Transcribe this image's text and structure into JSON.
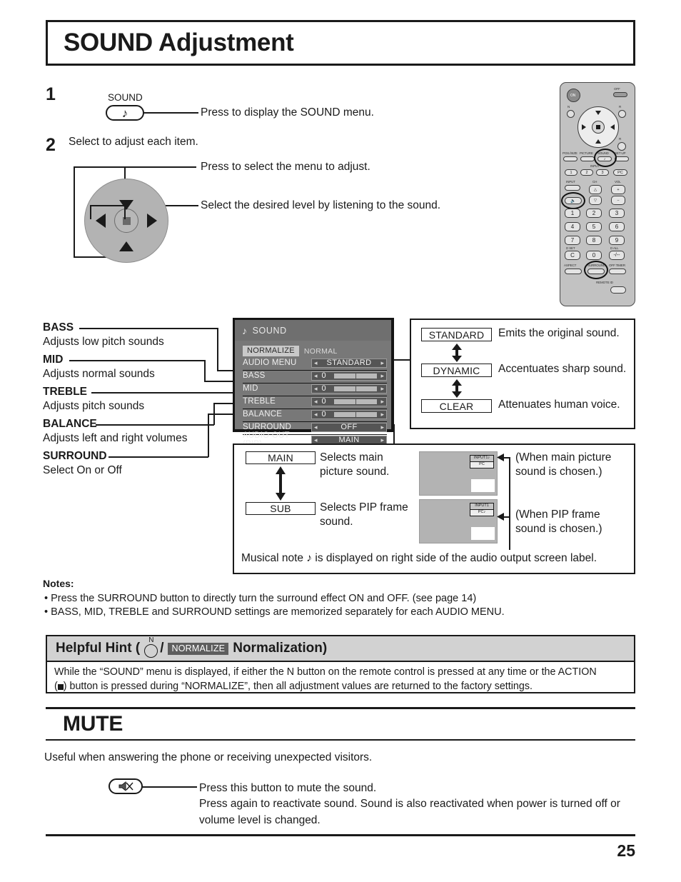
{
  "page": {
    "title": "SOUND Adjustment",
    "number": "25"
  },
  "steps": [
    {
      "num": "1",
      "button_label": "SOUND",
      "button_icon": "music-note-icon",
      "text": "Press to display the SOUND menu."
    },
    {
      "num": "2",
      "heading": "Select to adjust each item.",
      "line1": "Press to select the menu to adjust.",
      "line2": "Select the desired level by listening to the sound."
    }
  ],
  "left_items": [
    {
      "name": "BASS",
      "desc": "Adjusts low pitch sounds"
    },
    {
      "name": "MID",
      "desc": "Adjusts normal sounds"
    },
    {
      "name": "TREBLE",
      "desc": "Adjusts pitch sounds"
    },
    {
      "name": "BALANCE",
      "desc": "Adjusts left and right volumes"
    },
    {
      "name": "SURROUND",
      "desc": "Select On or Off"
    }
  ],
  "osd": {
    "title": "SOUND",
    "title_icon": "music-note-icon",
    "normalize_badge": "NORMALIZE",
    "normalize_value": "NORMAL",
    "rows": [
      {
        "label": "AUDIO MENU",
        "value": "STANDARD",
        "type": "value"
      },
      {
        "label": "BASS",
        "value": "0",
        "type": "slider"
      },
      {
        "label": "MID",
        "value": "0",
        "type": "slider"
      },
      {
        "label": "TREBLE",
        "value": "0",
        "type": "slider"
      },
      {
        "label": "BALANCE",
        "value": "0",
        "type": "slider"
      },
      {
        "label": "SURROUND",
        "value": "OFF",
        "type": "value"
      },
      {
        "label": "AUDIO OUT (PIP)",
        "value": "MAIN",
        "type": "value"
      }
    ],
    "arrow_left": "◂",
    "arrow_right": "▸"
  },
  "audio_menu_panel": {
    "options": [
      {
        "label": "STANDARD",
        "desc": "Emits the original sound."
      },
      {
        "label": "DYNAMIC",
        "desc": "Accentuates sharp sound."
      },
      {
        "label": "CLEAR",
        "desc": "Attenuates human voice."
      }
    ]
  },
  "audio_out_panel": {
    "options": [
      {
        "label": "MAIN",
        "desc_line1": "Selects main",
        "desc_line2": "picture sound."
      },
      {
        "label": "SUB",
        "desc_line1": "Selects PIP frame",
        "desc_line2": "sound."
      }
    ],
    "screens": [
      {
        "osd_line1": "INPUT1",
        "osd_line2": "PC",
        "note_on": "line1",
        "caption_line1": "(When main picture",
        "caption_line2": "sound is chosen.)"
      },
      {
        "osd_line1": "INPUT1",
        "osd_line2": "PC",
        "note_on": "line2",
        "caption_line1": "(When PIP frame",
        "caption_line2": "sound is chosen.)"
      }
    ],
    "footer": "Musical note ♪ is displayed on right side of the audio output screen label."
  },
  "notes": {
    "title": "Notes:",
    "items": [
      "• Press the SURROUND button to directly turn the surround effect ON and OFF. (see page 14)",
      "• BASS, MID, TREBLE and SURROUND settings are memorized separately for each AUDIO MENU."
    ]
  },
  "hint": {
    "prefix": "Helpful Hint (",
    "n_letter": "N",
    "separator": "/",
    "normalize_badge": "NORMALIZE",
    "suffix": "Normalization)",
    "body_line1": "While the “SOUND” menu is displayed, if either the N button on the remote control is pressed at any time or the ACTION",
    "body_line2_pre": "(",
    "body_line2_post": ") button is pressed during “NORMALIZE”, then all adjustment values are returned to the factory settings."
  },
  "mute": {
    "title": "MUTE",
    "intro": "Useful when answering the phone or receiving unexpected visitors.",
    "button_icon": "mute-speaker-icon",
    "line1": "Press this button to mute the sound.",
    "line2": "Press again to reactivate sound. Sound is also reactivated when power is turned off or",
    "line3": "volume level is changed."
  },
  "remote": {
    "on": "ON",
    "off": "OFF",
    "n": "N",
    "r_top": "R",
    "r_side": "R",
    "pos_size": "POS./SIZE",
    "picture": "PICTURE",
    "sound": "SOUND",
    "setup": "SET UP",
    "input_group": "INPUT",
    "input_keys": [
      "1",
      "2",
      "3",
      "PC"
    ],
    "input": "INPUT",
    "ch": "CH",
    "vol": "VOL",
    "mute_icon": "mute-speaker-icon",
    "numpad": [
      "1",
      "2",
      "3",
      "4",
      "5",
      "6",
      "7",
      "8",
      "9",
      "C",
      "0",
      "-/--"
    ],
    "d_set": "D SET",
    "d_all": "D ALL",
    "aspect": "ASPECT",
    "surround": "SURROUND",
    "off_timer": "OFF TIMER",
    "remote_id": "REMOTE  ID"
  },
  "colors": {
    "ink": "#1a1a1a",
    "osd_bg": "#787878",
    "osd_ctrl": "#555555",
    "osd_bar": "#b9b9b9",
    "disc": "#b3b3b3",
    "hint_head": "#d2d2d2",
    "badge": "#5e5e5e"
  }
}
